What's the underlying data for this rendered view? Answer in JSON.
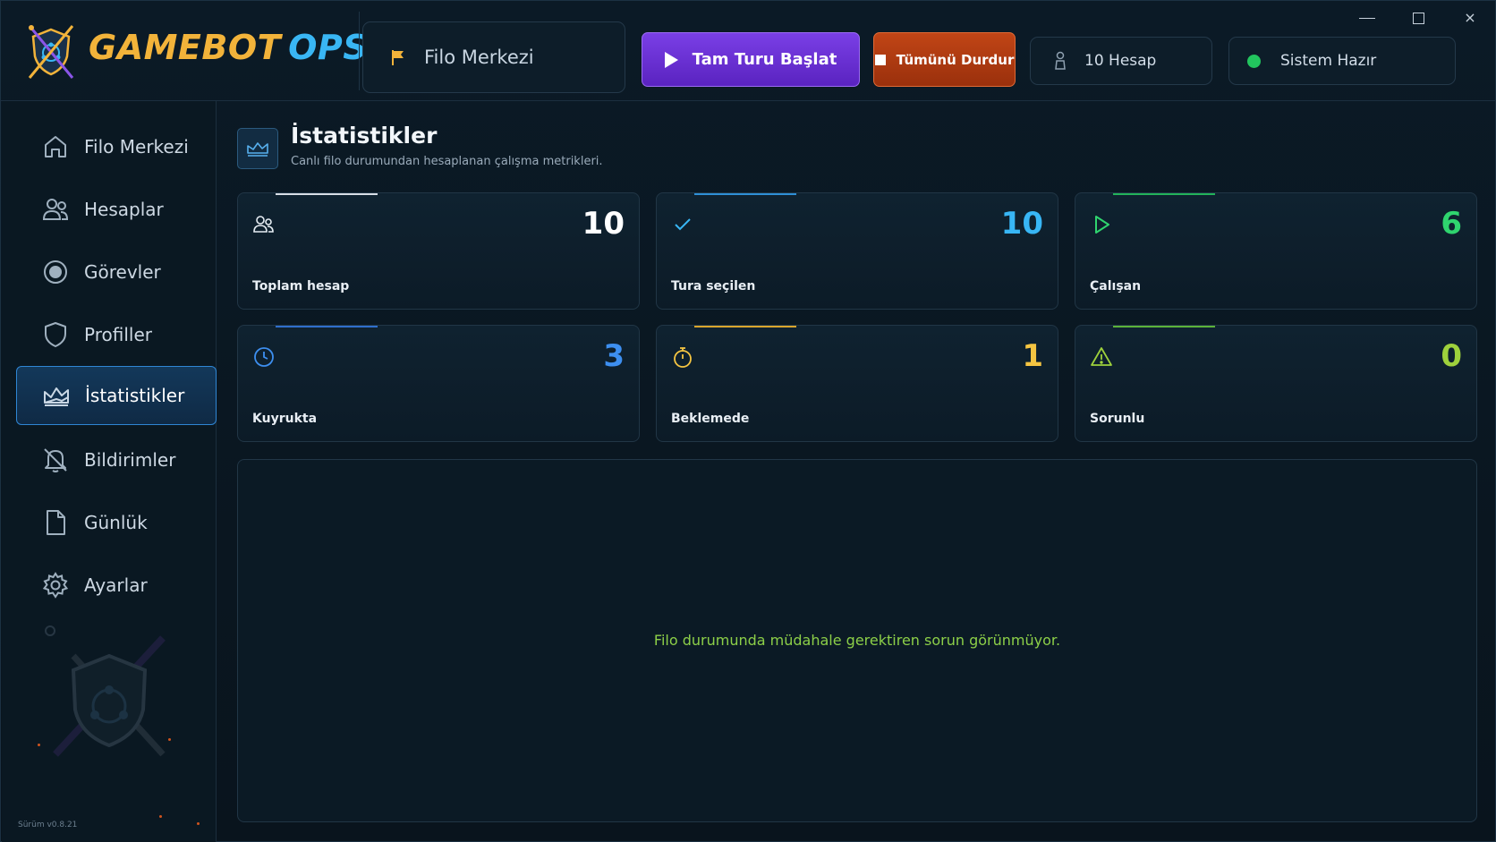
{
  "app": {
    "logo_part1": "GAMEBOT",
    "logo_part2": "OPS"
  },
  "header": {
    "breadcrumb": "Filo Merkezi",
    "start_button": "Tam Turu Başlat",
    "stop_button": "Tümünü Durdur",
    "accounts_pill": "10 Hesap",
    "status_pill": "Sistem Hazır",
    "window_close": "×"
  },
  "sidebar": {
    "items": [
      {
        "label": "Filo Merkezi",
        "icon": "home-icon"
      },
      {
        "label": "Hesaplar",
        "icon": "users-icon"
      },
      {
        "label": "Görevler",
        "icon": "target-icon"
      },
      {
        "label": "Profiller",
        "icon": "shield-icon"
      },
      {
        "label": "İstatistikler",
        "icon": "chart-icon",
        "active": true
      },
      {
        "label": "Bildirimler",
        "icon": "bell-off-icon"
      },
      {
        "label": "Günlük",
        "icon": "file-icon"
      },
      {
        "label": "Ayarlar",
        "icon": "gear-icon"
      }
    ],
    "version": "Sürüm v0.8.21"
  },
  "page": {
    "title": "İstatistikler",
    "subtitle": "Canlı filo durumundan hesaplanan çalışma metrikleri."
  },
  "stats": [
    {
      "label": "Toplam hesap",
      "value": "10",
      "icon": "users-icon",
      "color": "#ffffff",
      "accent": "#d7dee6"
    },
    {
      "label": "Tura seçilen",
      "value": "10",
      "icon": "check-icon",
      "color": "#38b6f5",
      "accent": "#2e8fd6"
    },
    {
      "label": "Çalışan",
      "value": "6",
      "icon": "play-icon",
      "color": "#2fd46e",
      "accent": "#22b35a"
    },
    {
      "label": "Kuyrukta",
      "value": "3",
      "icon": "clock-icon",
      "color": "#3d8ff0",
      "accent": "#2f6fcc"
    },
    {
      "label": "Beklemede",
      "value": "1",
      "icon": "timer-icon",
      "color": "#f5c542",
      "accent": "#d9a52d"
    },
    {
      "label": "Sorunlu",
      "value": "0",
      "icon": "warning-icon",
      "color": "#9ed13c",
      "accent": "#5cb23a"
    }
  ],
  "panel": {
    "message": "Filo durumunda müdahale gerektiren sorun görünmüyor."
  }
}
